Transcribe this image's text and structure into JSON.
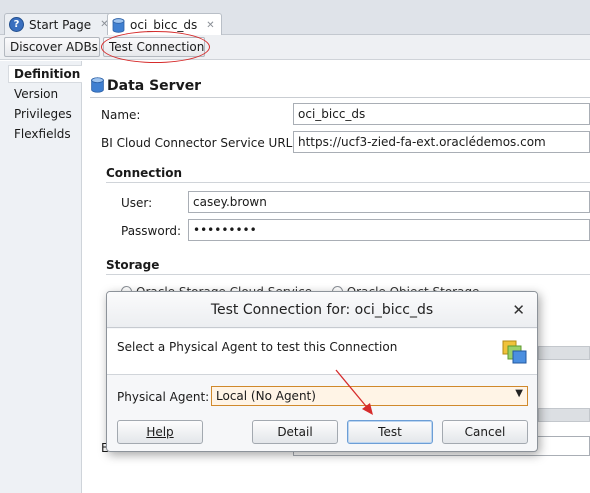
{
  "tabs": [
    {
      "label": "Start Page",
      "icon": "help-icon"
    },
    {
      "label": "oci_bicc_ds",
      "icon": "datastore-icon",
      "active": true
    }
  ],
  "toolbar": {
    "discover_label": "Discover ADBs",
    "test_connection_label": "Test Connection"
  },
  "sidebar": {
    "items": [
      {
        "label": "Definition",
        "selected": true
      },
      {
        "label": "Version"
      },
      {
        "label": "Privileges"
      },
      {
        "label": "Flexfields"
      }
    ]
  },
  "form": {
    "section_title": "Data Server",
    "name_label": "Name:",
    "name_value": "oci_bicc_ds",
    "url_label": "BI Cloud Connector Service URL:",
    "url_value": "https://ucf3-zied-fa-ext.oraclédemos.com",
    "connection_heading": "Connection",
    "user_label": "User:",
    "user_value": "casey.brown",
    "password_label": "Password:",
    "password_value": "•••••••••",
    "storage_heading": "Storage",
    "storage_option_1": "Oracle Storage Cloud Service",
    "storage_option_2": "Oracle Object Storage",
    "partial_label": "E"
  },
  "dialog": {
    "title": "Test Connection for: oci_bicc_ds",
    "message": "Select a Physical Agent to test this Connection",
    "agent_label": "Physical Agent:",
    "agent_value": "Local (No Agent)",
    "help_label": "Help",
    "detail_label": "Detail",
    "test_label": "Test",
    "cancel_label": "Cancel"
  },
  "colors": {
    "annotation_red": "#d62c2c",
    "select_highlight": "#d0892c"
  }
}
